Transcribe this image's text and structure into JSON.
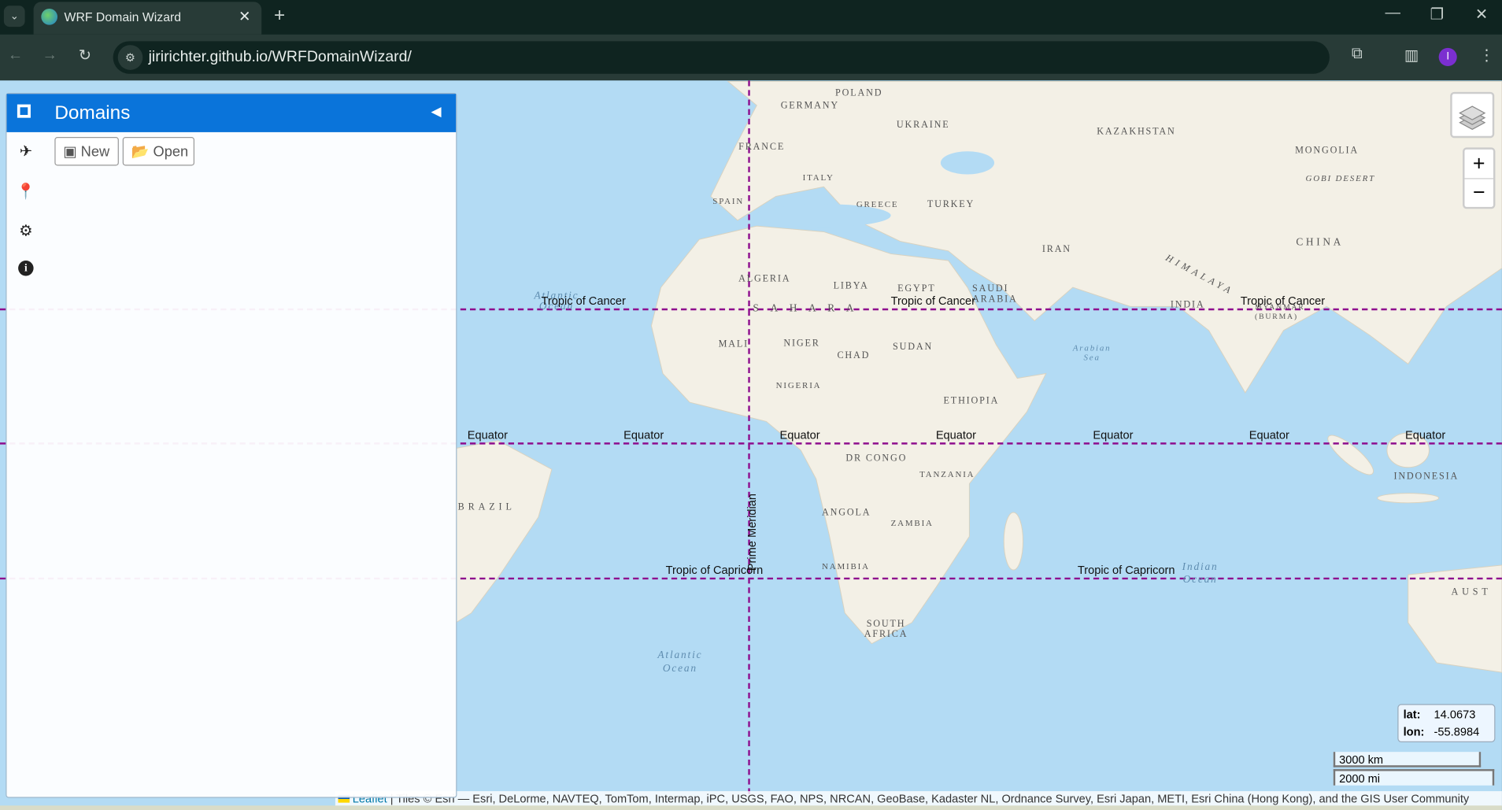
{
  "browser": {
    "tab_title": "WRF Domain Wizard",
    "url": "jiririchter.github.io/WRFDomainWizard/",
    "profile_initial": "I"
  },
  "panel": {
    "title": "Domains",
    "new_label": "New",
    "open_label": "Open"
  },
  "map": {
    "labels": [
      "POLAND",
      "GERMANY",
      "UKRAINE",
      "KAZAKHSTAN",
      "MONGOLIA",
      "GOBI DESERT",
      "FRANCE",
      "ITALY",
      "SPAIN",
      "GREECE",
      "TURKEY",
      "IRAN",
      "CHINA",
      "HIMALAYA",
      "ALGERIA",
      "LIBYA",
      "EGYPT",
      "SAUDI ARABIA",
      "SAHARA",
      "INDIA",
      "MYANMAR (BURMA)",
      "MALI",
      "NIGER",
      "CHAD",
      "SUDAN",
      "NIGERIA",
      "ETHIOPIA",
      "DR CONGO",
      "TANZANIA",
      "ANGOLA",
      "ZAMBIA",
      "NAMIBIA",
      "SOUTH AFRICA",
      "INDONESIA",
      "BRAZIL",
      "AUST"
    ],
    "oceans": [
      "Atlantic Ocean",
      "Arabian Sea",
      "Atlantic Ocean",
      "Indian Ocean"
    ],
    "gridlines": {
      "tropic_cancer": "Tropic of Cancer",
      "equator": "Equator",
      "tropic_capricorn": "Tropic of Capricorn",
      "prime_meridian": "Prime Meridian"
    },
    "gridline_color": "#8e0e8e",
    "coords": {
      "lat_label": "lat:",
      "lat": "14.0673",
      "lon_label": "lon:",
      "lon": "-55.8984"
    },
    "scale": {
      "metric": "3000 km",
      "imperial": "2000 mi"
    },
    "attribution": {
      "leaflet": "Leaflet",
      "text": "| Tiles © Esri — Esri, DeLorme, NAVTEQ, TomTom, Intermap, iPC, USGS, FAO, NPS, NRCAN, GeoBase, Kadaster NL, Ordnance Survey, Esri Japan, METI, Esri China (Hong Kong), and the GIS User Community"
    },
    "zoom_in": "+",
    "zoom_out": "−"
  },
  "colors": {
    "header_blue": "#0a74da",
    "ocean": "#b3dbf4",
    "land": "#f3f0e6"
  }
}
